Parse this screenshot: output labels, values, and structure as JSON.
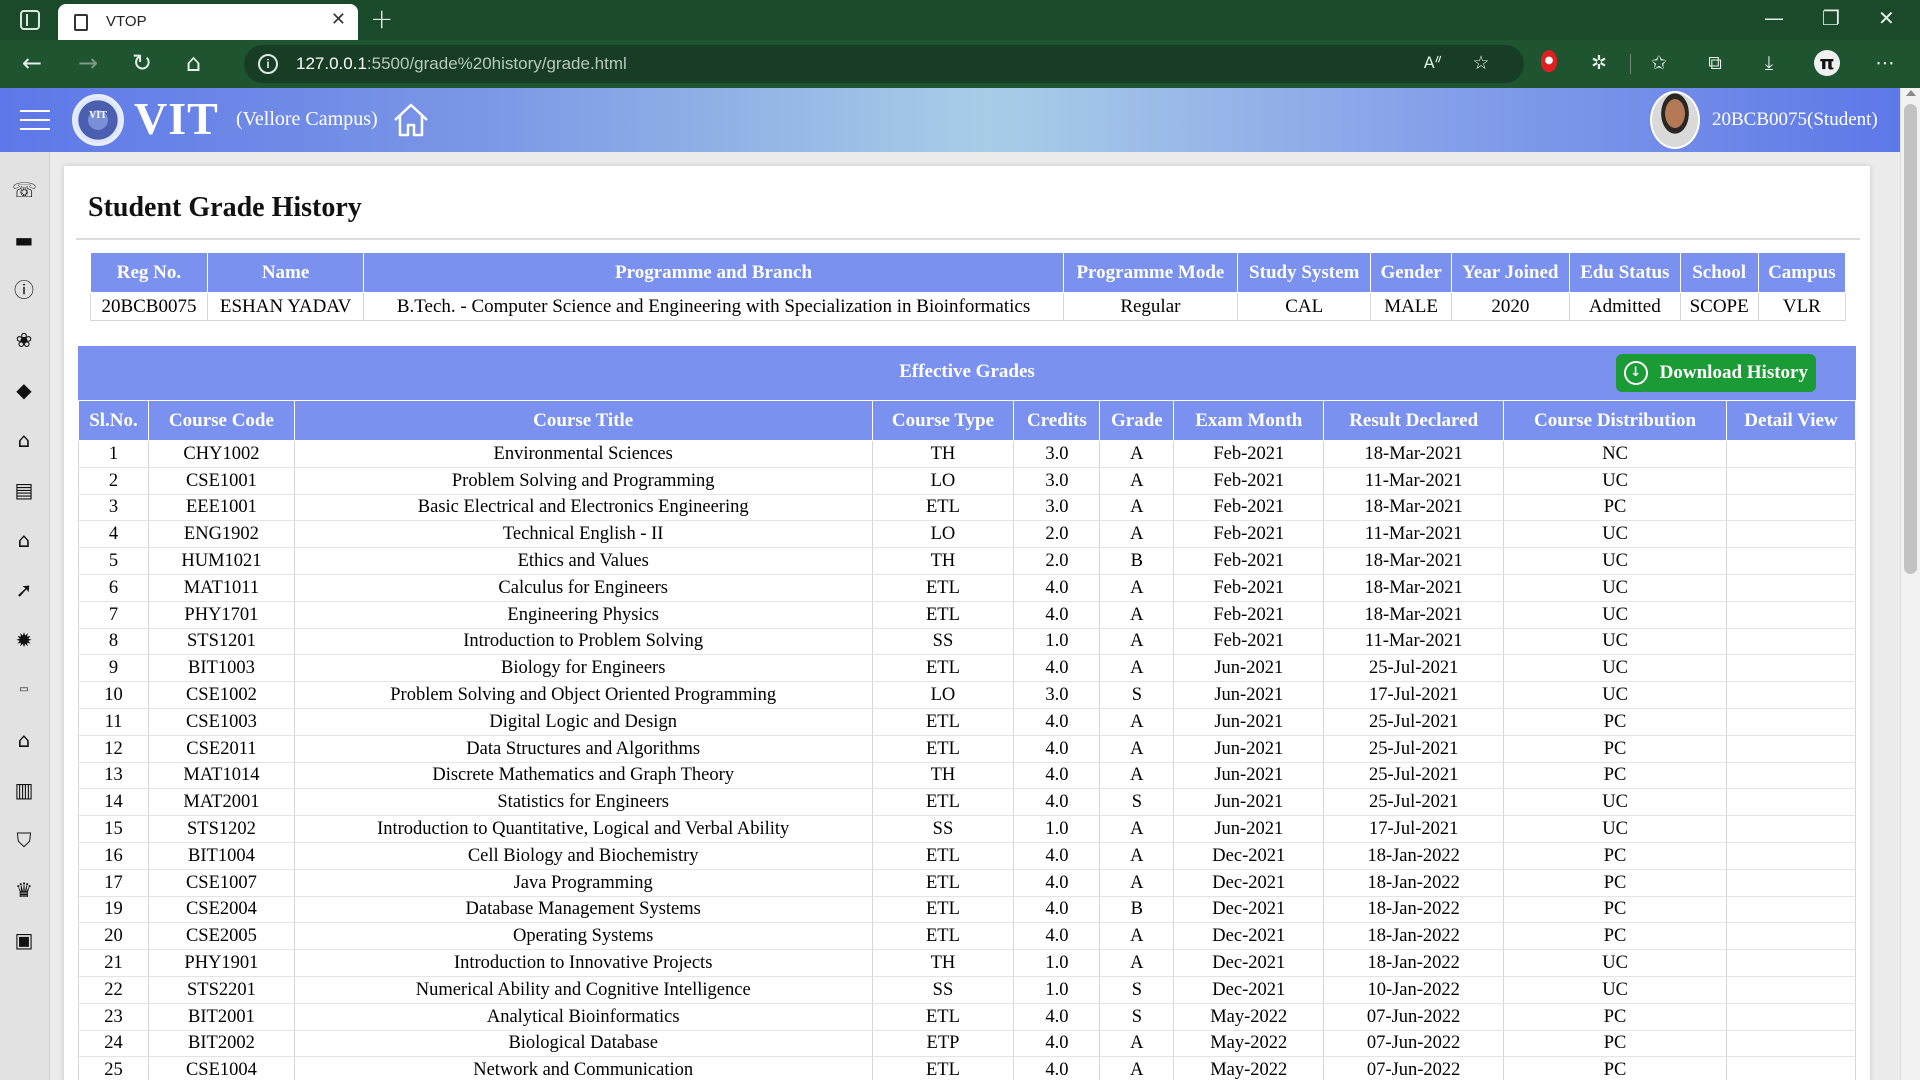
{
  "browser": {
    "tab_title": "VTOP",
    "url_host": "127.0.0.1",
    "url_path": ":5500/grade%20history/grade.html"
  },
  "header": {
    "logo_text": "VIT",
    "campus": "(Vellore Campus)",
    "user": "20BCB0075(Student)"
  },
  "sidebar_icons": [
    "phone-icon",
    "briefcase-icon",
    "info-icon",
    "paw-icon",
    "graduation-cap-icon",
    "institution-icon",
    "book-open-icon",
    "building-columns-icon",
    "rocket-icon",
    "gear-badge-icon",
    "visa-card-icon",
    "home-icon",
    "book-icon",
    "shield-icon",
    "trophy-icon",
    "lock-icon"
  ],
  "page": {
    "title": "Student Grade History"
  },
  "student": {
    "headers": [
      "Reg No.",
      "Name",
      "Programme and Branch",
      "Programme Mode",
      "Study System",
      "Gender",
      "Year Joined",
      "Edu Status",
      "School",
      "Campus"
    ],
    "values": [
      "20BCB0075",
      "ESHAN YADAV",
      "B.Tech. - Computer Science and Engineering with Specialization in Bioinformatics",
      "Regular",
      "CAL",
      "MALE",
      "2020",
      "Admitted",
      "SCOPE",
      "VLR"
    ]
  },
  "grades": {
    "title": "Effective Grades",
    "download_label": "Download History",
    "headers": [
      "Sl.No.",
      "Course Code",
      "Course Title",
      "Course Type",
      "Credits",
      "Grade",
      "Exam Month",
      "Result Declared",
      "Course Distribution",
      "Detail View"
    ],
    "rows": [
      [
        "1",
        "CHY1002",
        "Environmental Sciences",
        "TH",
        "3.0",
        "A",
        "Feb-2021",
        "18-Mar-2021",
        "NC",
        ""
      ],
      [
        "2",
        "CSE1001",
        "Problem Solving and Programming",
        "LO",
        "3.0",
        "A",
        "Feb-2021",
        "11-Mar-2021",
        "UC",
        ""
      ],
      [
        "3",
        "EEE1001",
        "Basic Electrical and Electronics Engineering",
        "ETL",
        "3.0",
        "A",
        "Feb-2021",
        "18-Mar-2021",
        "PC",
        ""
      ],
      [
        "4",
        "ENG1902",
        "Technical English - II",
        "LO",
        "2.0",
        "A",
        "Feb-2021",
        "11-Mar-2021",
        "UC",
        ""
      ],
      [
        "5",
        "HUM1021",
        "Ethics and Values",
        "TH",
        "2.0",
        "B",
        "Feb-2021",
        "18-Mar-2021",
        "UC",
        ""
      ],
      [
        "6",
        "MAT1011",
        "Calculus for Engineers",
        "ETL",
        "4.0",
        "A",
        "Feb-2021",
        "18-Mar-2021",
        "UC",
        ""
      ],
      [
        "7",
        "PHY1701",
        "Engineering Physics",
        "ETL",
        "4.0",
        "A",
        "Feb-2021",
        "18-Mar-2021",
        "UC",
        ""
      ],
      [
        "8",
        "STS1201",
        "Introduction to Problem Solving",
        "SS",
        "1.0",
        "A",
        "Feb-2021",
        "11-Mar-2021",
        "UC",
        ""
      ],
      [
        "9",
        "BIT1003",
        "Biology for Engineers",
        "ETL",
        "4.0",
        "A",
        "Jun-2021",
        "25-Jul-2021",
        "UC",
        ""
      ],
      [
        "10",
        "CSE1002",
        "Problem Solving and Object Oriented Programming",
        "LO",
        "3.0",
        "S",
        "Jun-2021",
        "17-Jul-2021",
        "UC",
        ""
      ],
      [
        "11",
        "CSE1003",
        "Digital Logic and Design",
        "ETL",
        "4.0",
        "A",
        "Jun-2021",
        "25-Jul-2021",
        "PC",
        ""
      ],
      [
        "12",
        "CSE2011",
        "Data Structures and Algorithms",
        "ETL",
        "4.0",
        "A",
        "Jun-2021",
        "25-Jul-2021",
        "PC",
        ""
      ],
      [
        "13",
        "MAT1014",
        "Discrete Mathematics and Graph Theory",
        "TH",
        "4.0",
        "A",
        "Jun-2021",
        "25-Jul-2021",
        "PC",
        ""
      ],
      [
        "14",
        "MAT2001",
        "Statistics for Engineers",
        "ETL",
        "4.0",
        "S",
        "Jun-2021",
        "25-Jul-2021",
        "UC",
        ""
      ],
      [
        "15",
        "STS1202",
        "Introduction to Quantitative, Logical and Verbal Ability",
        "SS",
        "1.0",
        "A",
        "Jun-2021",
        "17-Jul-2021",
        "UC",
        ""
      ],
      [
        "16",
        "BIT1004",
        "Cell Biology and Biochemistry",
        "ETL",
        "4.0",
        "A",
        "Dec-2021",
        "18-Jan-2022",
        "PC",
        ""
      ],
      [
        "17",
        "CSE1007",
        "Java Programming",
        "ETL",
        "4.0",
        "A",
        "Dec-2021",
        "18-Jan-2022",
        "PC",
        ""
      ],
      [
        "19",
        "CSE2004",
        "Database Management Systems",
        "ETL",
        "4.0",
        "B",
        "Dec-2021",
        "18-Jan-2022",
        "PC",
        ""
      ],
      [
        "20",
        "CSE2005",
        "Operating Systems",
        "ETL",
        "4.0",
        "A",
        "Dec-2021",
        "18-Jan-2022",
        "PC",
        ""
      ],
      [
        "21",
        "PHY1901",
        "Introduction to Innovative Projects",
        "TH",
        "1.0",
        "A",
        "Dec-2021",
        "18-Jan-2022",
        "UC",
        ""
      ],
      [
        "22",
        "STS2201",
        "Numerical Ability and Cognitive Intelligence",
        "SS",
        "1.0",
        "S",
        "Dec-2021",
        "10-Jan-2022",
        "UC",
        ""
      ],
      [
        "23",
        "BIT2001",
        "Analytical Bioinformatics",
        "ETL",
        "4.0",
        "S",
        "May-2022",
        "07-Jun-2022",
        "PC",
        ""
      ],
      [
        "24",
        "BIT2002",
        "Biological Database",
        "ETP",
        "4.0",
        "A",
        "May-2022",
        "07-Jun-2022",
        "PC",
        ""
      ],
      [
        "25",
        "CSE1004",
        "Network and Communication",
        "ETL",
        "4.0",
        "A",
        "May-2022",
        "07-Jun-2022",
        "PC",
        ""
      ]
    ]
  }
}
